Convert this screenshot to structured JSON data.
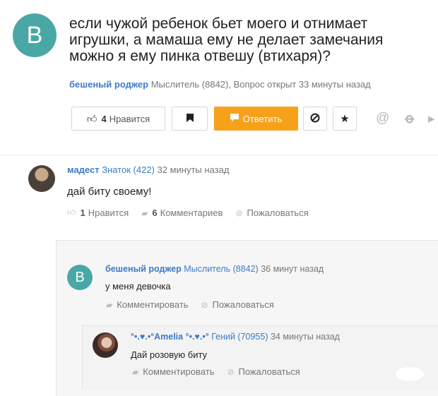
{
  "question": {
    "avatar_letter": "B",
    "title": "если чужой ребенок бьет моего и отнимает\nигрушки, а мамаша ему не делает замечания\nможно я ему пинка отвешу (втихаря)?",
    "author": "бешеный роджер",
    "rank": "Мыслитель (8842),",
    "opened": "Вопрос открыт 33 минуты назад"
  },
  "toolbar": {
    "like_count": "4",
    "like_label": "Нравится",
    "answer_label": "Ответить"
  },
  "answer": {
    "author": "мадест",
    "rank": "Знаток (422)",
    "time": "32 минуты назад",
    "text": "дай биту своему!",
    "likes_count": "1",
    "likes_label": "Нравится",
    "comments_count": "6",
    "comments_label": "Комментариев",
    "report_label": "Пожаловаться"
  },
  "comments": [
    {
      "avatar_letter": "B",
      "author": "бешеный роджер",
      "rank": "Мыслитель (8842)",
      "time": "36 минут назад",
      "text": "у меня девочка",
      "comment_label": "Комментировать",
      "report_label": "Пожаловаться"
    },
    {
      "author": "°•.♥.•°Amelia °•.♥.•°",
      "rank": "Гений (70955)",
      "time": "34 минуты назад",
      "text": "Дай розовую биту",
      "comment_label": "Комментировать",
      "report_label": "Пожаловаться"
    }
  ],
  "colors": {
    "accent_orange": "#f7a11b",
    "avatar_teal": "#49a8a6",
    "link_blue": "#3d7bc6"
  }
}
